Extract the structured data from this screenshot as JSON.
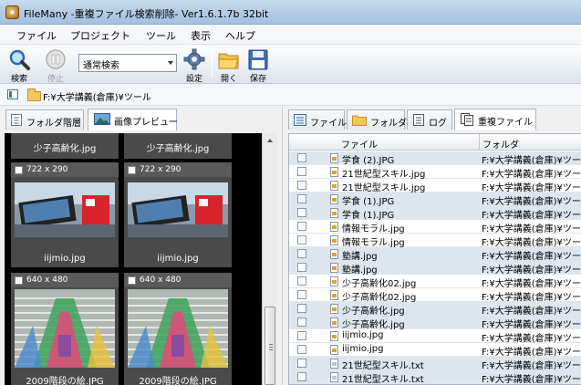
{
  "window": {
    "title": "FileMany -重複ファイル検索削除- Ver1.6.1.7b 32bit"
  },
  "menu": {
    "items": [
      "ファイル",
      "プロジェクト",
      "ツール",
      "表示",
      "ヘルプ"
    ]
  },
  "toolbar": {
    "search_label": "検索",
    "stop_label": "停止",
    "search_mode": "通常検索",
    "settings_label": "設定",
    "open_label": "開く",
    "save_label": "保存"
  },
  "path": {
    "current": "F:¥大学講義(倉庫)¥ツール"
  },
  "left_panel": {
    "tabs": [
      "フォルダ階層",
      "画像プレビュー"
    ],
    "active_tab": "画像プレビュー",
    "thumbnails": [
      {
        "name": "少子高齢化.jpg",
        "dims": "",
        "scene": "partial"
      },
      {
        "name": "少子高齢化.jpg",
        "dims": "",
        "scene": "partial"
      },
      {
        "name": "iijmio.jpg",
        "dims": "722 x 290",
        "scene": "device"
      },
      {
        "name": "iijmio.jpg",
        "dims": "722 x 290",
        "scene": "device"
      },
      {
        "name": "2009階段の絵.JPG",
        "dims": "640 x 480",
        "scene": "stairs"
      },
      {
        "name": "2009階段の絵.JPG",
        "dims": "640 x 480",
        "scene": "stairs"
      }
    ]
  },
  "right_panel": {
    "tabs": [
      "ファイル",
      "フォルダ",
      "ログ",
      "重複ファイル"
    ],
    "active_tab": "重複ファイル",
    "columns": {
      "file": "ファイル",
      "folder": "フォルダ"
    },
    "rows": [
      {
        "name": "学食 (2).JPG",
        "folder": "F:¥大学講義(倉庫)¥ツール",
        "shade": true,
        "type": "img"
      },
      {
        "name": "21世紀型スキル.jpg",
        "folder": "F:¥大学講義(倉庫)¥ツール",
        "shade": false,
        "type": "img"
      },
      {
        "name": "21世紀型スキル.jpg",
        "folder": "F:¥大学講義(倉庫)¥ツール",
        "shade": false,
        "type": "img"
      },
      {
        "name": "学食 (1).JPG",
        "folder": "F:¥大学講義(倉庫)¥ツール",
        "shade": true,
        "type": "img"
      },
      {
        "name": "学食 (1).JPG",
        "folder": "F:¥大学講義(倉庫)¥ツール",
        "shade": true,
        "type": "img"
      },
      {
        "name": "情報モラル.jpg",
        "folder": "F:¥大学講義(倉庫)¥ツール",
        "shade": false,
        "type": "img"
      },
      {
        "name": "情報モラル.jpg",
        "folder": "F:¥大学講義(倉庫)¥ツール",
        "shade": false,
        "type": "img"
      },
      {
        "name": "塾講.jpg",
        "folder": "F:¥大学講義(倉庫)¥ツール",
        "shade": true,
        "type": "img"
      },
      {
        "name": "塾講.jpg",
        "folder": "F:¥大学講義(倉庫)¥ツール",
        "shade": true,
        "type": "img"
      },
      {
        "name": "少子高齢化02.jpg",
        "folder": "F:¥大学講義(倉庫)¥ツール",
        "shade": false,
        "type": "img"
      },
      {
        "name": "少子高齢化02.jpg",
        "folder": "F:¥大学講義(倉庫)¥ツール",
        "shade": false,
        "type": "img"
      },
      {
        "name": "少子高齢化.jpg",
        "folder": "F:¥大学講義(倉庫)¥ツール",
        "shade": true,
        "type": "img"
      },
      {
        "name": "少子高齢化.jpg",
        "folder": "F:¥大学講義(倉庫)¥ツール",
        "shade": true,
        "type": "img"
      },
      {
        "name": "iijmio.jpg",
        "folder": "F:¥大学講義(倉庫)¥ツール",
        "shade": false,
        "type": "img"
      },
      {
        "name": "iijmio.jpg",
        "folder": "F:¥大学講義(倉庫)¥ツール",
        "shade": false,
        "type": "img"
      },
      {
        "name": "21世紀型スキル.txt",
        "folder": "F:¥大学講義(倉庫)¥ツール",
        "shade": true,
        "type": "txt"
      },
      {
        "name": "21世紀型スキル.txt",
        "folder": "F:¥大学講義(倉庫)¥ツール",
        "shade": true,
        "type": "txt"
      }
    ]
  },
  "colors": {
    "row_shade": "#dde5ee",
    "title_bar": "#b5cde6",
    "thumb_bg": "#000000"
  }
}
